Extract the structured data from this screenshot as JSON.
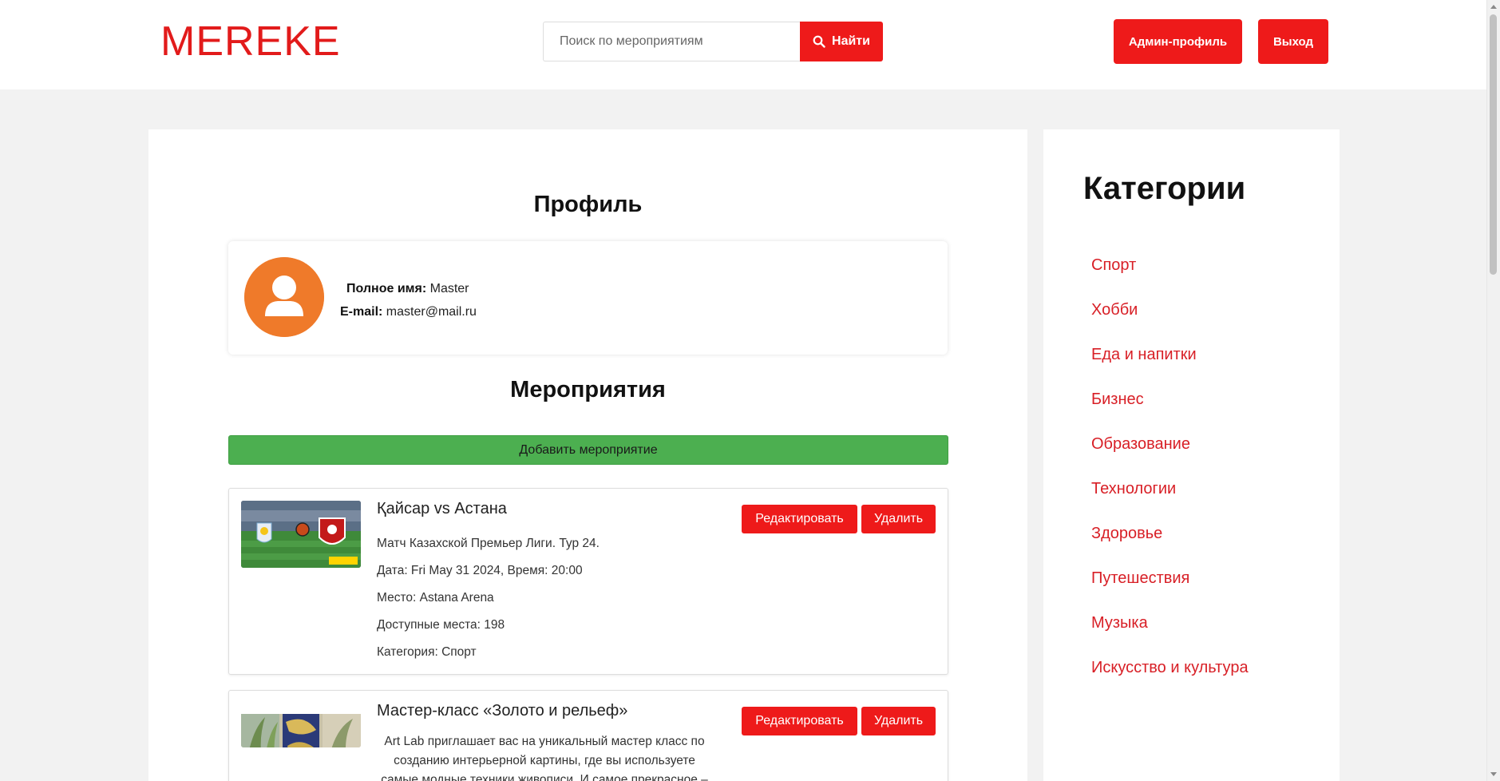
{
  "header": {
    "logo": "MEREKE",
    "search_placeholder": "Поиск по мероприятиям",
    "search_button": "Найти",
    "admin_button": "Админ-профиль",
    "logout_button": "Выход"
  },
  "profile": {
    "title": "Профиль",
    "name_label": "Полное имя:",
    "name_value": "Master",
    "email_label": "E-mail:",
    "email_value": "master@mail.ru"
  },
  "events": {
    "title": "Мероприятия",
    "add_button": "Добавить мероприятие",
    "items": [
      {
        "title": "Қайсар vs Астана",
        "description": "Матч Казахской Премьер Лиги. Тур 24.",
        "datetime": "Дата: Fri May 31 2024, Время: 20:00",
        "place": "Место: Astana Arena",
        "seats": "Доступные места: 198",
        "category": "Категория: Спорт",
        "edit_label": "Редактировать",
        "delete_label": "Удалить"
      },
      {
        "title": "Мастер-класс «Золото и рельеф»",
        "description": "Art Lab приглашает вас на уникальный мастер класс по созданию интерьерной картины, где вы используете самые модные техники живописи. И самое прекрасное –",
        "edit_label": "Редактировать",
        "delete_label": "Удалить"
      }
    ]
  },
  "sidebar": {
    "title": "Категории",
    "categories": [
      "Спорт",
      "Хобби",
      "Еда и напитки",
      "Бизнес",
      "Образование",
      "Технологии",
      "Здоровье",
      "Путешествия",
      "Музыка",
      "Искусство и культура"
    ]
  },
  "colors": {
    "accent": "#ee1a1a",
    "add_button": "#4caf50",
    "avatar": "#ef7a2a",
    "category_link": "#d81f26"
  }
}
